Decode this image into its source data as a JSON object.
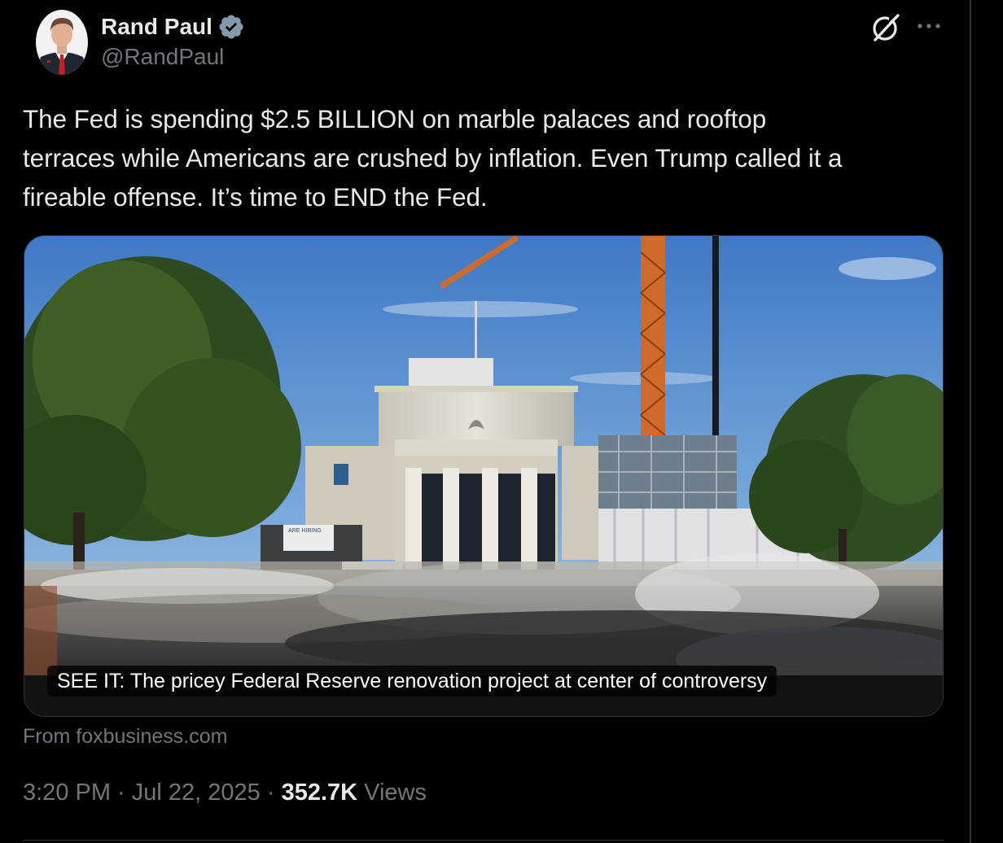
{
  "author": {
    "display_name": "Rand Paul",
    "handle": "@RandPaul",
    "verified": true
  },
  "tweet": {
    "text": "The Fed is spending $2.5 BILLION on marble palaces and rooftop\nterraces while Americans are crushed by inflation. Even Trump called it a\nfireable offense. It’s time to END the Fed."
  },
  "link_card": {
    "caption": "SEE IT: The pricey Federal Reserve renovation project at center of controversy",
    "source": "From foxbusiness.com",
    "sign_text": "ARE HIRING"
  },
  "meta": {
    "time": "3:20 PM",
    "separator": " · ",
    "date": "Jul 22, 2025",
    "views_count": "352.7K",
    "views_label": " Views"
  },
  "icons": {
    "verified": "verified-badge-icon",
    "grok": "grok-icon",
    "more": "more-dots-icon"
  },
  "colors": {
    "background": "#000000",
    "text": "#e7e9ea",
    "secondary": "#71767b",
    "verified_badge": "#829aab",
    "border": "#2f3336"
  }
}
